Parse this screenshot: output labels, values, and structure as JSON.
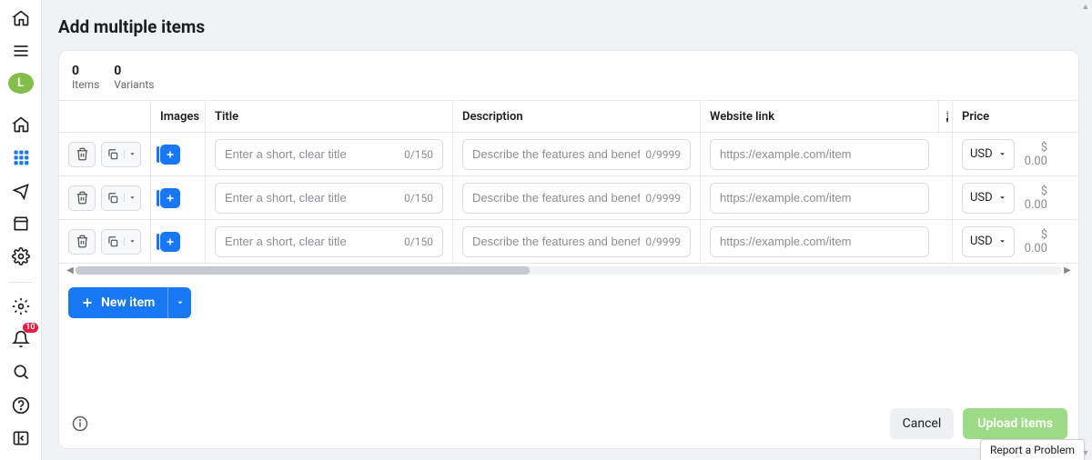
{
  "page": {
    "title": "Add multiple items"
  },
  "counters": {
    "items": {
      "value": "0",
      "label": "Items"
    },
    "variants": {
      "value": "0",
      "label": "Variants"
    }
  },
  "columns": {
    "images": "Images",
    "title": "Title",
    "description": "Description",
    "website": "Website link",
    "price": "Price"
  },
  "row_defaults": {
    "title_placeholder": "Enter a short, clear title",
    "title_counter": "0/150",
    "desc_placeholder": "Describe the features and benefits",
    "desc_counter": "0/9999",
    "link_placeholder": "https://example.com/item",
    "currency": "USD",
    "price": "$ 0.00"
  },
  "rows": [
    {},
    {},
    {}
  ],
  "actions": {
    "new_item": "New item",
    "cancel": "Cancel",
    "upload": "Upload items",
    "report": "Report a Problem"
  },
  "sidenav": {
    "avatar_initial": "L",
    "notify_badge": "10"
  }
}
